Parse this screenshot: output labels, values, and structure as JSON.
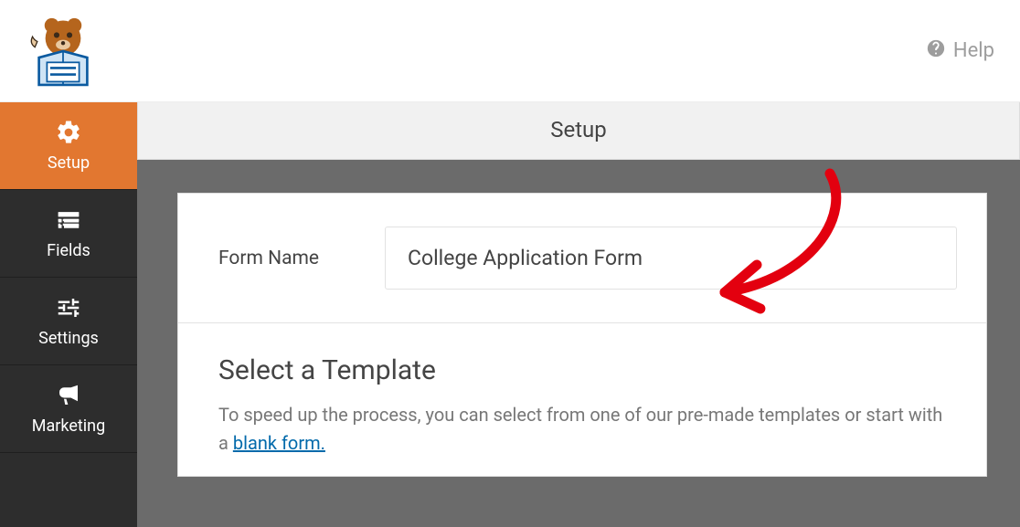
{
  "topbar": {
    "help_label": "Help"
  },
  "sidebar": {
    "items": [
      {
        "label": "Setup"
      },
      {
        "label": "Fields"
      },
      {
        "label": "Settings"
      },
      {
        "label": "Marketing"
      }
    ]
  },
  "content": {
    "header": "Setup",
    "form_name_label": "Form Name",
    "form_name_value": "College Application Form",
    "template_title": "Select a Template",
    "template_desc_prefix": "To speed up the process, you can select from one of our pre-made templates or start with a ",
    "template_link": "blank form."
  }
}
